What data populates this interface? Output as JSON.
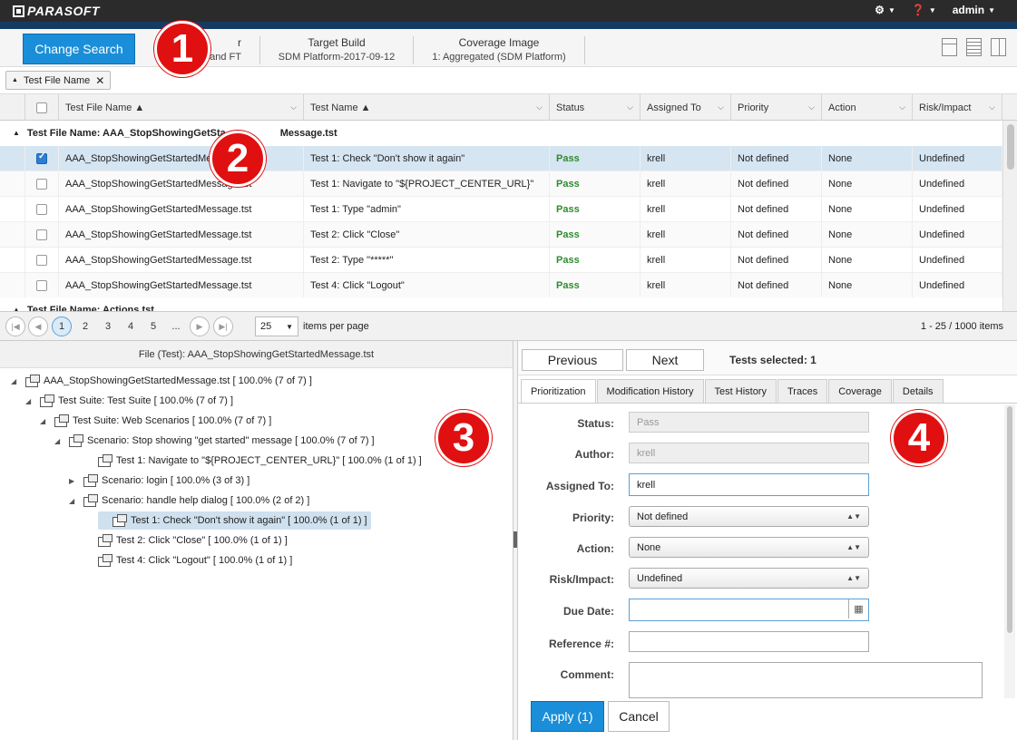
{
  "topbar": {
    "logo": "PARASOFT",
    "user": "admin"
  },
  "search": {
    "change_button": "Change Search",
    "columns": [
      {
        "title": "r",
        "value": "and FT"
      },
      {
        "title": "Target Build",
        "value": "SDM Platform-2017-09-12"
      },
      {
        "title": "Coverage Image",
        "value": "1: Aggregated (SDM Platform)"
      }
    ]
  },
  "group_chip": "Test File Name",
  "grid": {
    "columns": [
      "Test File Name",
      "Test Name",
      "Status",
      "Assigned To",
      "Priority",
      "Action",
      "Risk/Impact"
    ],
    "group1": "Test File Name: AAA_StopShowingGetStartedMessage.tst",
    "group1_visible": "Test File Name: AAA_StopShowingGetSta",
    "group1_tail": "Message.tst",
    "group2": "Test File Name: Actions.tst",
    "rows": [
      {
        "file": "AAA_StopShowingGetStartedMessage.tst",
        "file_visible": "AAA_StopShowingGetStartedMes",
        "test": "Test 1: Check \"Don't show it again\"",
        "status": "Pass",
        "assigned": "krell",
        "priority": "Not defined",
        "action": "None",
        "risk": "Undefined",
        "checked": true
      },
      {
        "file": "AAA_StopShowingGetStartedMessage.tst",
        "test": "Test 1: Navigate to \"${PROJECT_CENTER_URL}\"",
        "status": "Pass",
        "assigned": "krell",
        "priority": "Not defined",
        "action": "None",
        "risk": "Undefined",
        "checked": false
      },
      {
        "file": "AAA_StopShowingGetStartedMessage.tst",
        "test": "Test 1: Type \"admin\"",
        "status": "Pass",
        "assigned": "krell",
        "priority": "Not defined",
        "action": "None",
        "risk": "Undefined",
        "checked": false
      },
      {
        "file": "AAA_StopShowingGetStartedMessage.tst",
        "test": "Test 2: Click \"Close\"",
        "status": "Pass",
        "assigned": "krell",
        "priority": "Not defined",
        "action": "None",
        "risk": "Undefined",
        "checked": false
      },
      {
        "file": "AAA_StopShowingGetStartedMessage.tst",
        "test": "Test 2: Type \"*****\"",
        "status": "Pass",
        "assigned": "krell",
        "priority": "Not defined",
        "action": "None",
        "risk": "Undefined",
        "checked": false
      },
      {
        "file": "AAA_StopShowingGetStartedMessage.tst",
        "test": "Test 4: Click \"Logout\"",
        "status": "Pass",
        "assigned": "krell",
        "priority": "Not defined",
        "action": "None",
        "risk": "Undefined",
        "checked": false
      }
    ]
  },
  "pager": {
    "pages": [
      "1",
      "2",
      "3",
      "4",
      "5",
      "..."
    ],
    "page_size": "25",
    "items_per_page": "items per page",
    "range": "1 - 25 / 1000 items"
  },
  "tree": {
    "title": "File (Test): AAA_StopShowingGetStartedMessage.tst",
    "nodes": [
      {
        "label": "AAA_StopShowingGetStartedMessage.tst   [ 100.0% (7 of 7) ]",
        "toggle": "◢"
      },
      {
        "label": "Test Suite: Test Suite   [ 100.0% (7 of 7) ]",
        "toggle": "◢"
      },
      {
        "label": "Test Suite: Web Scenarios   [ 100.0% (7 of 7) ]",
        "toggle": "◢"
      },
      {
        "label": "Scenario: Stop showing \"get started\" message   [ 100.0% (7 of 7) ]",
        "toggle": "◢"
      },
      {
        "label": "Test 1: Navigate to \"${PROJECT_CENTER_URL}\"   [ 100.0% (1 of 1) ]",
        "toggle": ""
      },
      {
        "label": "Scenario: login   [ 100.0% (3 of 3) ]",
        "toggle": "▶"
      },
      {
        "label": "Scenario: handle help dialog   [ 100.0% (2 of 2) ]",
        "toggle": "◢"
      },
      {
        "label": "Test 1: Check \"Don't show it again\"   [ 100.0% (1 of 1) ]",
        "toggle": ""
      },
      {
        "label": "Test 2: Click \"Close\"   [ 100.0% (1 of 1) ]",
        "toggle": ""
      },
      {
        "label": "Test 4: Click \"Logout\"   [ 100.0% (1 of 1) ]",
        "toggle": ""
      }
    ]
  },
  "detail": {
    "previous": "Previous",
    "next": "Next",
    "tests_selected": "Tests selected: 1",
    "tabs": [
      "Prioritization",
      "Modification History",
      "Test History",
      "Traces",
      "Coverage",
      "Details"
    ],
    "labels": {
      "status": "Status:",
      "author": "Author:",
      "assigned": "Assigned To:",
      "priority": "Priority:",
      "action": "Action:",
      "risk": "Risk/Impact:",
      "due": "Due Date:",
      "ref": "Reference #:",
      "comment": "Comment:"
    },
    "values": {
      "status": "Pass",
      "author": "krell",
      "assigned": "krell",
      "priority": "Not defined",
      "action": "None",
      "risk": "Undefined",
      "due": "",
      "ref": ""
    },
    "apply": "Apply (1)",
    "cancel": "Cancel"
  },
  "badges": [
    "1",
    "2",
    "3",
    "4"
  ]
}
